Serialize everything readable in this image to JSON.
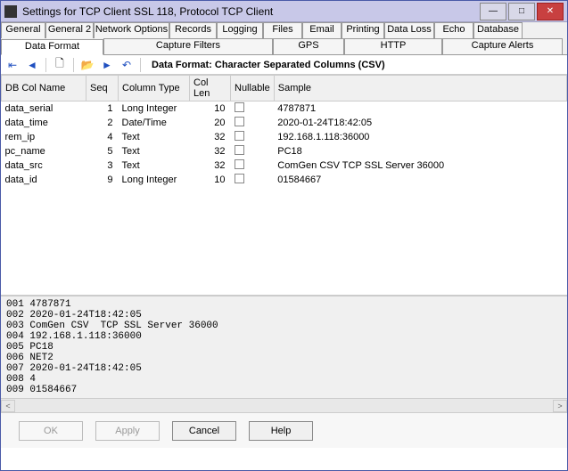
{
  "window": {
    "title": "Settings for TCP Client SSL 118, Protocol TCP Client"
  },
  "tabs_row1": [
    {
      "label": "General",
      "w": 50
    },
    {
      "label": "General 2",
      "w": 54
    },
    {
      "label": "Network Options",
      "w": 85
    },
    {
      "label": "Records",
      "w": 53
    },
    {
      "label": "Logging",
      "w": 52
    },
    {
      "label": "Files",
      "w": 44
    },
    {
      "label": "Email",
      "w": 44
    },
    {
      "label": "Printing",
      "w": 48
    },
    {
      "label": "Data Loss",
      "w": 56
    },
    {
      "label": "Echo",
      "w": 44
    },
    {
      "label": "Database",
      "w": 55
    }
  ],
  "tabs_row2": [
    {
      "label": "Data Format",
      "active": true,
      "w": 115
    },
    {
      "label": "Capture Filters",
      "w": 190
    },
    {
      "label": "GPS",
      "w": 80
    },
    {
      "label": "HTTP",
      "w": 110
    },
    {
      "label": "Capture Alerts",
      "w": 135
    }
  ],
  "toolbar": {
    "heading": "Data Format: Character Separated Columns (CSV)"
  },
  "columns": [
    "DB Col Name",
    "Seq",
    "Column Type",
    "Col Len",
    "Nullable",
    "Sample"
  ],
  "rows": [
    {
      "name": "data_serial",
      "seq": 1,
      "type": "Long Integer",
      "len": 10,
      "nullable": false,
      "sample": "4787871"
    },
    {
      "name": "data_time",
      "seq": 2,
      "type": "Date/Time",
      "len": 20,
      "nullable": false,
      "sample": "2020-01-24T18:42:05"
    },
    {
      "name": "rem_ip",
      "seq": 4,
      "type": "Text",
      "len": 32,
      "nullable": false,
      "sample": "192.168.1.118:36000"
    },
    {
      "name": "pc_name",
      "seq": 5,
      "type": "Text",
      "len": 32,
      "nullable": false,
      "sample": "PC18"
    },
    {
      "name": "data_src",
      "seq": 3,
      "type": "Text",
      "len": 32,
      "nullable": false,
      "sample": "ComGen CSV  TCP SSL Server 36000"
    },
    {
      "name": "data_id",
      "seq": 9,
      "type": "Long Integer",
      "len": 10,
      "nullable": false,
      "sample": "01584667"
    }
  ],
  "preview_lines": [
    "001 4787871",
    "002 2020-01-24T18:42:05",
    "003 ComGen CSV  TCP SSL Server 36000",
    "004 192.168.1.118:36000",
    "005 PC18",
    "006 NET2",
    "007 2020-01-24T18:42:05",
    "008 4",
    "009 01584667"
  ],
  "buttons": {
    "ok": "OK",
    "apply": "Apply",
    "cancel": "Cancel",
    "help": "Help"
  }
}
